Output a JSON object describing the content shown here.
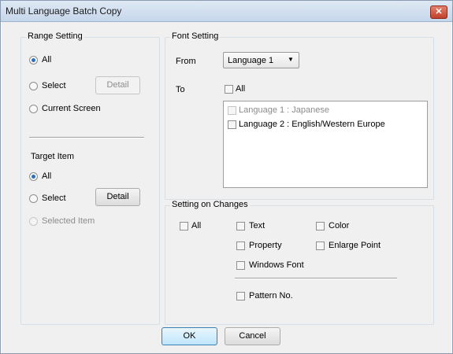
{
  "window": {
    "title": "Multi Language Batch Copy",
    "close_glyph": "✕"
  },
  "range_setting": {
    "label": "Range Setting",
    "options": [
      {
        "label": "All",
        "selected": true
      },
      {
        "label": "Select",
        "selected": false
      },
      {
        "label": "Current Screen",
        "selected": false
      }
    ],
    "detail_label": "Detail"
  },
  "target_item": {
    "label": "Target Item",
    "options": [
      {
        "label": "All",
        "selected": true
      },
      {
        "label": "Select",
        "selected": false
      },
      {
        "label": "Selected Item",
        "selected": false,
        "disabled": true
      }
    ],
    "detail_label": "Detail"
  },
  "font_setting": {
    "label": "Font Setting",
    "from_label": "From",
    "from_value": "Language 1",
    "to_label": "To",
    "to_all_label": "All",
    "languages": [
      {
        "label": "Language 1 : Japanese",
        "checked": false,
        "disabled": true
      },
      {
        "label": "Language 2 : English/Western Europe",
        "checked": false,
        "disabled": false
      }
    ]
  },
  "setting_on_changes": {
    "label": "Setting on Changes",
    "all_label": "All",
    "text_label": "Text",
    "color_label": "Color",
    "property_label": "Property",
    "enlarge_point_label": "Enlarge Point",
    "windows_font_label": "Windows Font",
    "pattern_no_label": "Pattern No."
  },
  "footer": {
    "ok_label": "OK",
    "cancel_label": "Cancel"
  }
}
